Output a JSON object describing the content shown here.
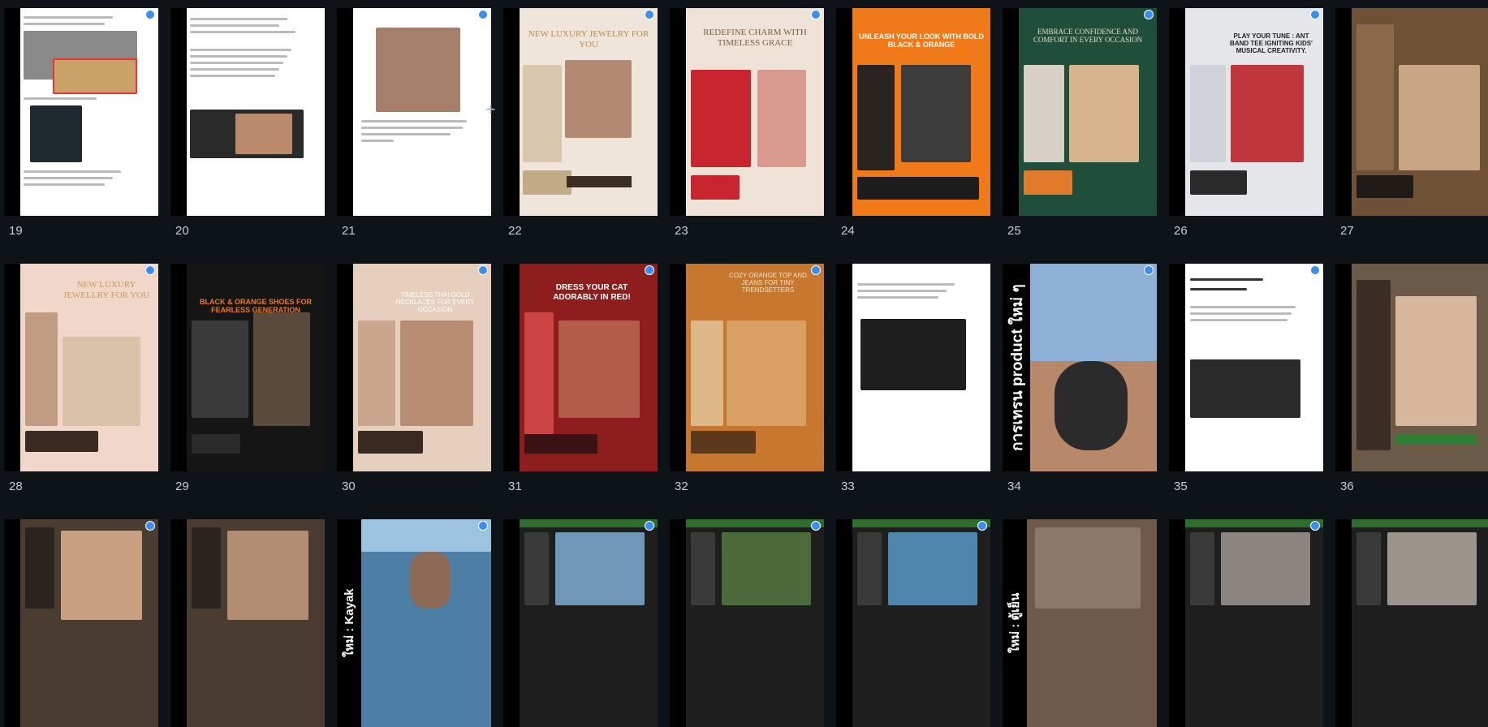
{
  "grid_numbers": [
    "19",
    "20",
    "21",
    "22",
    "23",
    "24",
    "25",
    "26",
    "27",
    "28",
    "29",
    "30",
    "31",
    "32",
    "33",
    "34",
    "35",
    "36"
  ],
  "add_slide_glyph": "+",
  "slides": {
    "s22": {
      "title": "NEW LUXURY JEWELRY FOR YOU"
    },
    "s23": {
      "title": "REDEFINE CHARM WITH TIMELESS GRACE"
    },
    "s24": {
      "title": "UNLEASH YOUR LOOK WITH BOLD BLACK & ORANGE"
    },
    "s25": {
      "title": "EMBRACE CONFIDENCE AND COMFORT IN EVERY OCCASION"
    },
    "s26": {
      "title": "PLAY YOUR TUNE : ANT BAND TEE IGNITING KIDS' MUSICAL CREATIVITY."
    },
    "s28": {
      "title": "NEW LUXURY JEWELLRY FOR YOU"
    },
    "s29": {
      "title": "BLACK & ORANGE SHOES FOR FEARLESS GENERATION"
    },
    "s30": {
      "title": "TIMELESS THAI GOLD NECKLACES FOR EVERY OCCASION"
    },
    "s31": {
      "title": "DRESS YOUR CAT ADORABLY IN RED!"
    },
    "s32": {
      "title": "COZY ORANGE TOP AND JEANS FOR TINY TRENDSETTERS"
    },
    "s34": {
      "vertical": "การเทรน product ใหม่ ๆ"
    },
    "s39": {
      "vertical": "ใหม่ : Kayak"
    },
    "s45": {
      "vertical": "ใหม่ : ตู้เย็น"
    }
  },
  "colors": {
    "bg": "#0e1318",
    "badge": "#3b8ef0"
  }
}
